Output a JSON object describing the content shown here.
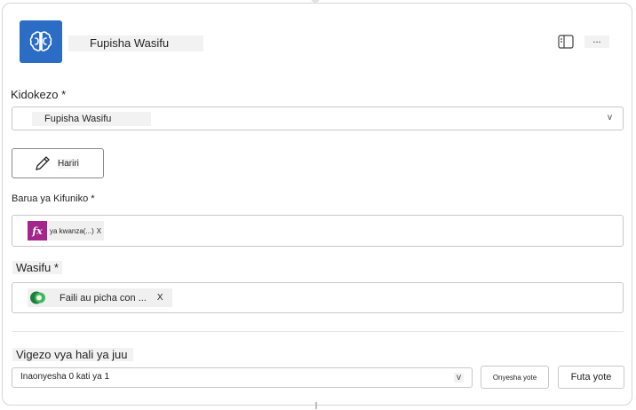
{
  "header": {
    "title": "Fupisha Wasifu",
    "more_label": "...",
    "app_icon": "ai-brain-icon",
    "panel_icon": "side-panel-icon"
  },
  "prompt": {
    "label": "Kidokezo *",
    "value": "Fupisha Wasifu",
    "chevron": "v"
  },
  "edit_button": {
    "label": "Hariri"
  },
  "cover_letter": {
    "label": "Barua ya Kifuniko *",
    "token_icon": "fx",
    "token_text": "ya kwanza(...)",
    "token_remove": "X"
  },
  "resume": {
    "label": "Wasifu *",
    "token_text": "Faili au picha con ...",
    "token_remove": "X"
  },
  "advanced": {
    "label": "Vigezo vya hali ya juu",
    "select_value": "Inaonyesha 0 kati ya 1",
    "chevron": "v",
    "show_all": "Onyesha yote",
    "clear_all": "Futa yote"
  },
  "colors": {
    "accent": "#2b6cc4",
    "fx": "#a4268d"
  }
}
